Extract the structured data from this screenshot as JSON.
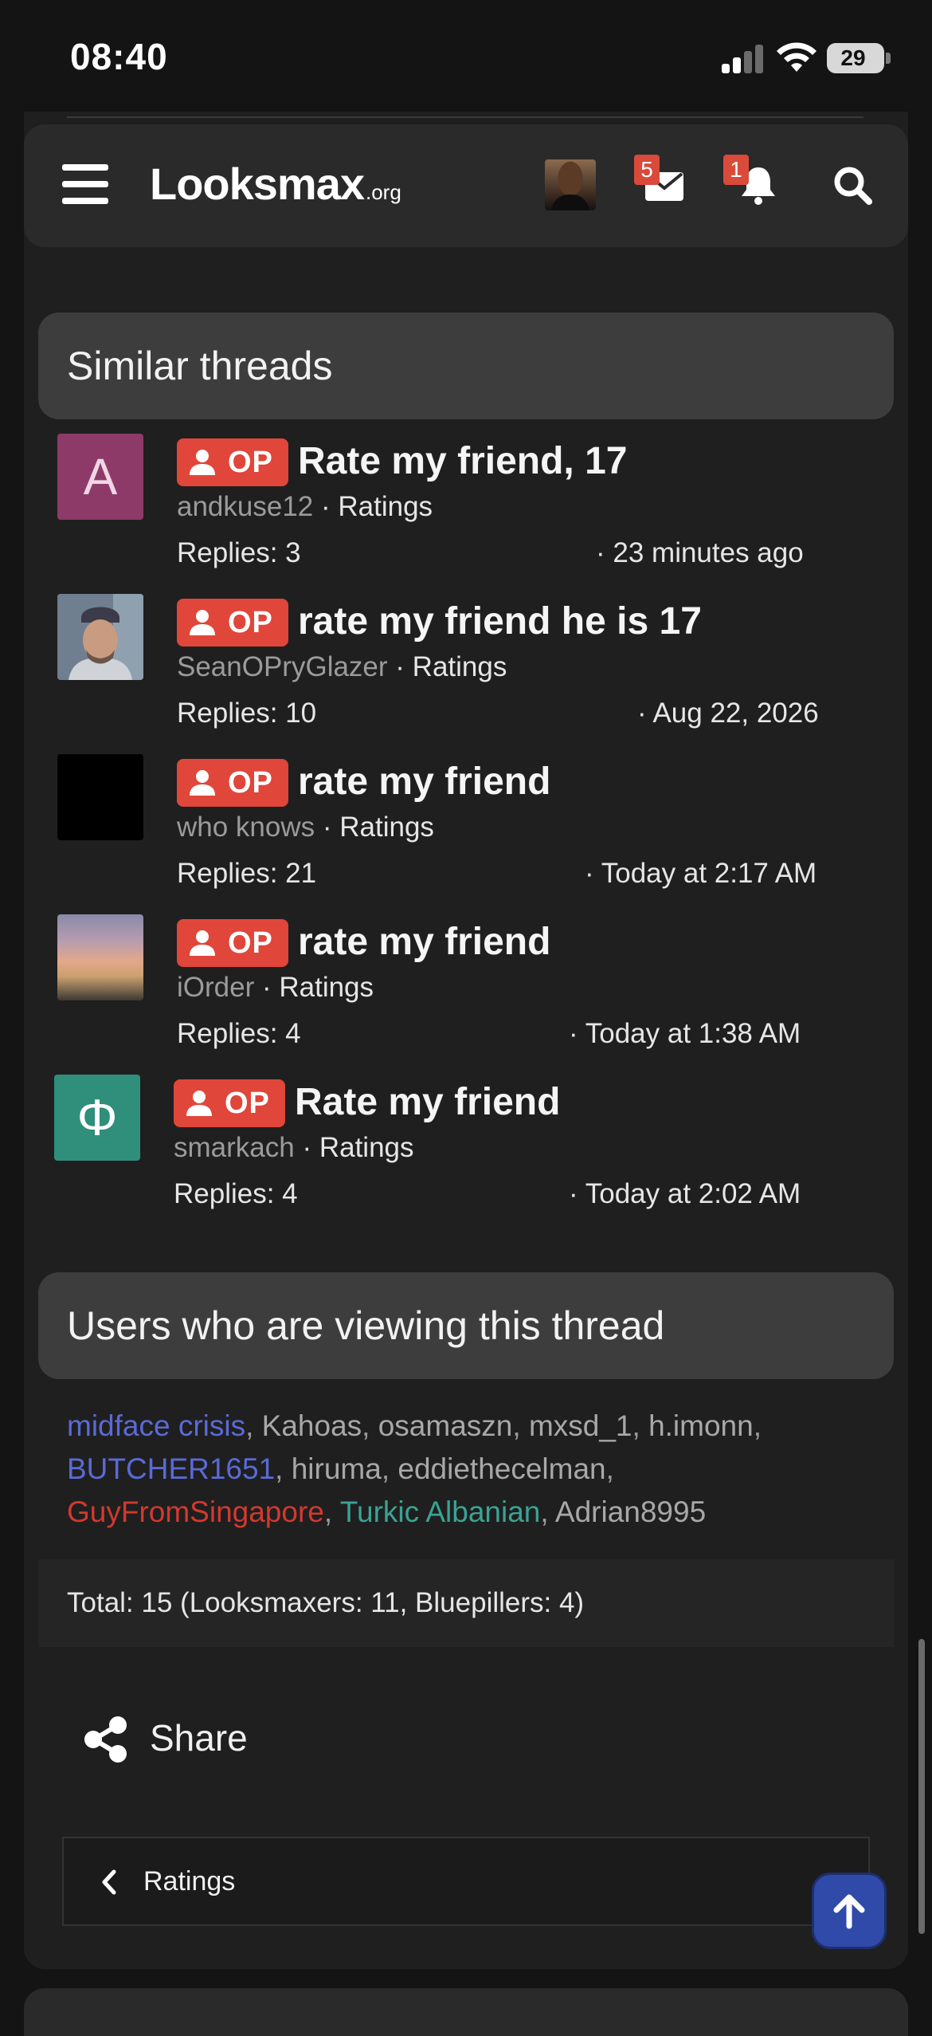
{
  "status_bar": {
    "time": "08:40",
    "battery": "29"
  },
  "header": {
    "logo_main": "Looksmax",
    "logo_sub": ".org",
    "messages_badge": "5",
    "alerts_badge": "1",
    "icons": [
      "menu-icon",
      "envelope-icon",
      "bell-icon",
      "search-icon"
    ]
  },
  "similar_threads": {
    "title": "Similar threads",
    "op_label": "OP",
    "items": [
      {
        "avatar_letter": "A",
        "title": "Rate my friend, 17",
        "author": "andkuse12",
        "forum": " · Ratings",
        "replies": "Replies: 3",
        "date": "· 23 minutes ago",
        "avatar_color": "#8e3a69"
      },
      {
        "avatar_letter": "",
        "title": "rate my friend he is 17",
        "author": "SeanOPryGlazer",
        "forum": " · Ratings",
        "replies": "Replies: 10",
        "date": "· Aug 22, 2026"
      },
      {
        "avatar_letter": "",
        "title": "rate my friend",
        "author": "who knows",
        "forum": " · Ratings",
        "replies": "Replies: 21",
        "date": "· Today at 2:17 AM",
        "avatar_color": "#000000"
      },
      {
        "avatar_letter": "",
        "title": "rate my friend",
        "author": "iOrder",
        "forum": " · Ratings",
        "replies": "Replies: 4",
        "date": "· Today at 1:38 AM"
      },
      {
        "avatar_letter": "Φ",
        "title": "Rate my friend",
        "author": "smarkach",
        "forum": " · Ratings",
        "replies": "Replies: 4",
        "date": "· Today at 2:02 AM",
        "avatar_color": "#2f8f7b"
      }
    ]
  },
  "viewers": {
    "title": "Users who are viewing this thread",
    "users": [
      {
        "name": "midface crisis",
        "color": "#5b6ad6"
      },
      {
        "name": "Kahoas"
      },
      {
        "name": "osamaszn"
      },
      {
        "name": "mxsd_1"
      },
      {
        "name": "h.imonn"
      },
      {
        "name": "BUTCHER1651",
        "color": "#5b6ad6"
      },
      {
        "name": "hiruma"
      },
      {
        "name": "eddiethecelman"
      },
      {
        "name": "GuyFromSingapore",
        "color": "#d2392f"
      },
      {
        "name": "Turkic Albanian",
        "color": "#3aa394"
      },
      {
        "name": "Adrian8995"
      }
    ],
    "separator": ", ",
    "total": "Total: 15 (Looksmaxers: 11, Bluepillers: 4)"
  },
  "share": {
    "label": "Share"
  },
  "breadcrumb": {
    "label": "Ratings"
  }
}
